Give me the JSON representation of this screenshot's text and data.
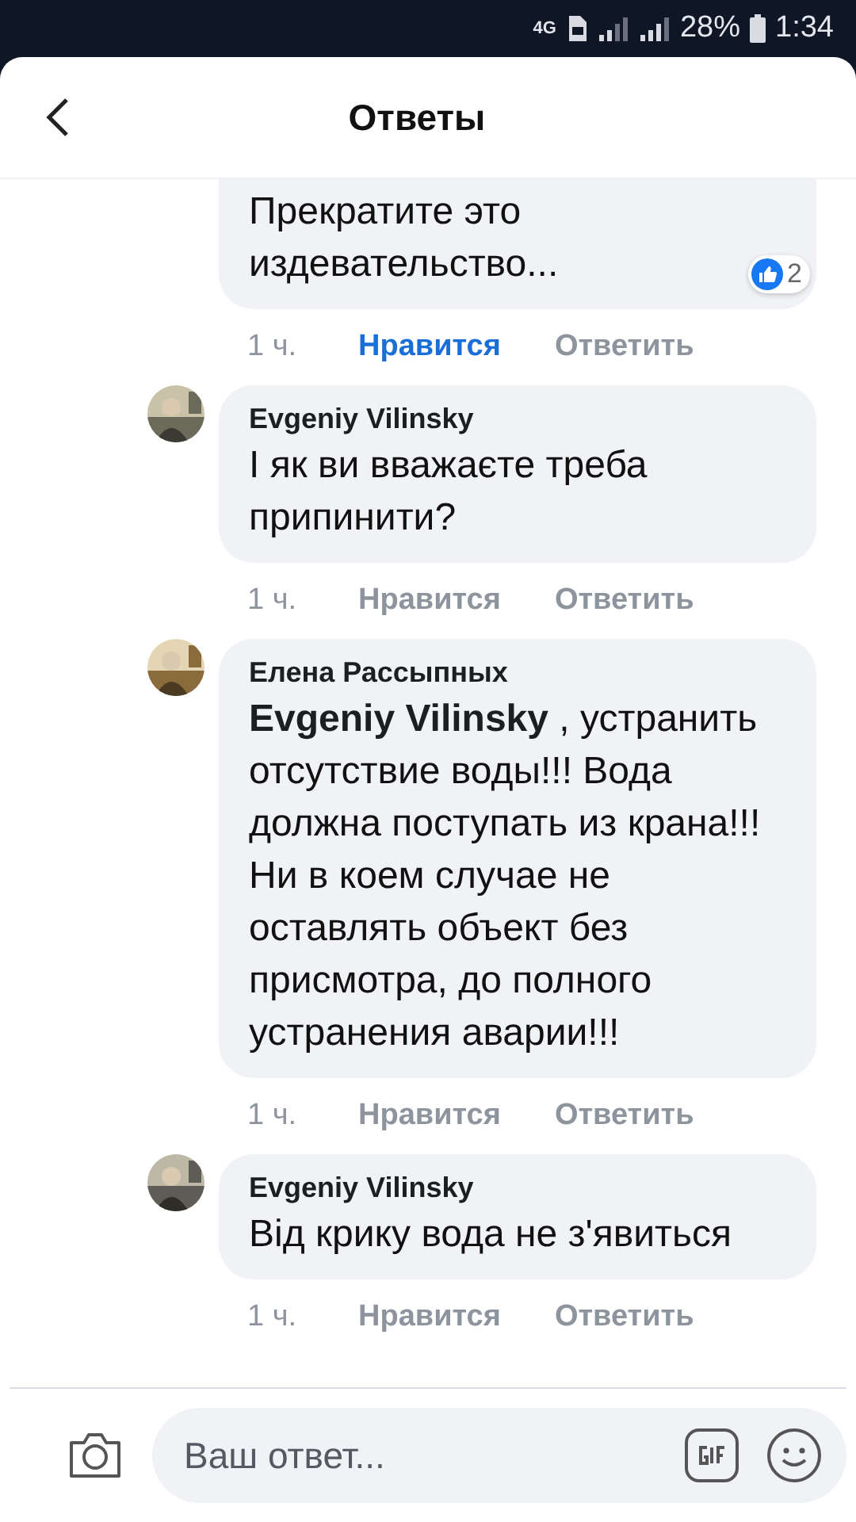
{
  "status_bar": {
    "network": "4G",
    "battery": "28%",
    "time": "1:34"
  },
  "header": {
    "title": "Ответы"
  },
  "comments": [
    {
      "text": "Прекратите это издевательство...",
      "reactions": "2",
      "time": "1 ч.",
      "like": "Нравится",
      "liked": true,
      "reply": "Ответить",
      "avatar": false
    },
    {
      "author": "Evgeniy Vilinsky",
      "text": "І як ви вважаєте треба припинити?",
      "time": "1 ч.",
      "like": "Нравится",
      "liked": false,
      "reply": "Ответить",
      "avatar": true
    },
    {
      "author": "Елена Рассыпных",
      "text": "**Evgeniy Vilinsky** , устранить отсутствие воды!!!  Вода должна поступать из крана!!!  Ни в коем случае не  оставлять  объект без присмотра,  до полного устранения аварии!!!",
      "time": "1 ч.",
      "like": "Нравится",
      "liked": false,
      "reply": "Ответить",
      "avatar": true
    },
    {
      "author": "Evgeniy Vilinsky",
      "text": "Від крику вода не з'явиться",
      "time": "1 ч.",
      "like": "Нравится",
      "liked": false,
      "reply": "Ответить",
      "avatar": true
    }
  ],
  "composer": {
    "placeholder": "Ваш ответ..."
  }
}
